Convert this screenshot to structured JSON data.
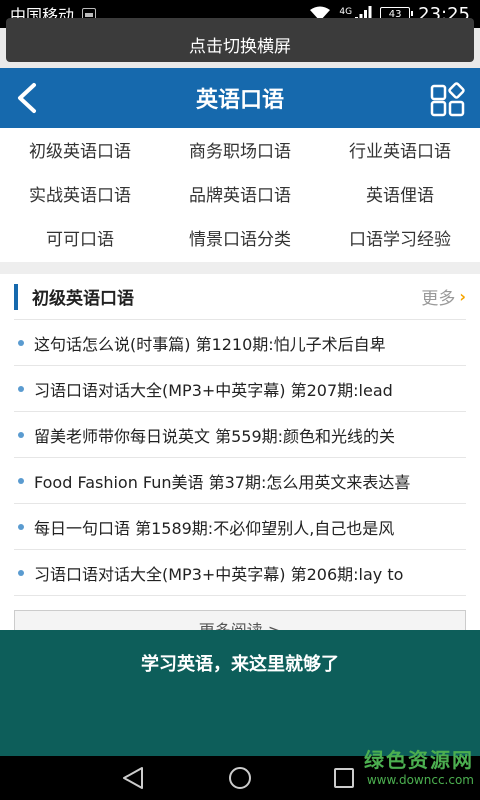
{
  "status_bar": {
    "carrier": "中国移动",
    "network": "4G",
    "battery": "43",
    "time": "23:25"
  },
  "top_button": {
    "label": "点击切换横屏"
  },
  "header": {
    "title": "英语口语",
    "back_icon": "chevron-left-icon",
    "grid_icon": "grid-menu-icon"
  },
  "categories": [
    "初级英语口语",
    "商务职场口语",
    "行业英语口语",
    "实战英语口语",
    "品牌英语口语",
    "英语俚语",
    "可可口语",
    "情景口语分类",
    "口语学习经验"
  ],
  "section": {
    "title": "初级英语口语",
    "more_label": "更多",
    "items": [
      "这句话怎么说(时事篇) 第1210期:怕儿子术后自卑",
      "习语口语对话大全(MP3+中英字幕) 第207期:lead",
      "留美老师带你每日说英文 第559期:颜色和光线的关",
      "Food Fashion Fun美语 第37期:怎么用英文来表达喜",
      "每日一句口语 第1589期:不必仰望别人,自己也是风",
      "习语口语对话大全(MP3+中英字幕) 第206期:lay to"
    ],
    "more_read_label": "更多阅读 >"
  },
  "banner": {
    "text": "学习英语，来这里就够了"
  },
  "watermark": {
    "name": "绿色资源网",
    "url": "www.downcc.com"
  },
  "colors": {
    "header_blue": "#1669ad",
    "banner_teal": "#0d5e5a",
    "accent_orange": "#f5a400"
  }
}
